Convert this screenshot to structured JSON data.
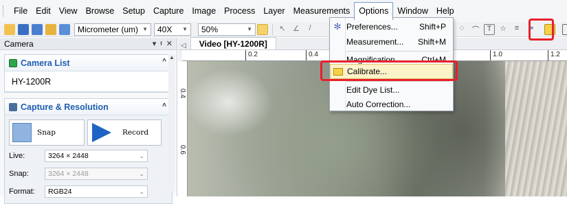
{
  "menubar": {
    "items": [
      "File",
      "Edit",
      "View",
      "Browse",
      "Setup",
      "Capture",
      "Image",
      "Process",
      "Layer",
      "Measurements",
      "Options",
      "Window",
      "Help"
    ],
    "active": "Options"
  },
  "toolbar": {
    "unit_select": "Micrometer (um)",
    "objective_select": "40X",
    "zoom_select": "50%"
  },
  "camera_panel": {
    "title": "Camera",
    "camera_list_title": "Camera List",
    "camera_name": "HY-1200R",
    "capture_title": "Capture & Resolution",
    "snap_label": "Snap",
    "record_label": "Record",
    "live_label": "Live:",
    "live_value": "3264 × 2448",
    "snap_res_label": "Snap:",
    "snap_res_value": "3264 × 2448",
    "format_label": "Format:",
    "format_value": "RGB24"
  },
  "document": {
    "tab_label": "Video [HY-1200R]",
    "ruler_h_labels": [
      "0.2",
      "0.4",
      "1.0",
      "1.2"
    ],
    "ruler_v_labels": [
      "0.4",
      "0.6"
    ]
  },
  "options_menu": {
    "items": [
      {
        "label": "Preferences...",
        "shortcut": "Shift+P",
        "icon": "gear-icon"
      },
      {
        "label": "Measurement...",
        "shortcut": "Shift+M",
        "icon": ""
      },
      {
        "label": "Magnification...",
        "shortcut": "Ctrl+M",
        "icon": ""
      },
      {
        "label": "Calibrate...",
        "shortcut": "",
        "icon": "calibrate-icon"
      },
      {
        "label": "Edit Dye List...",
        "shortcut": "",
        "icon": ""
      },
      {
        "label": "Auto Correction...",
        "shortcut": "",
        "icon": ""
      }
    ],
    "highlighted": "Calibrate..."
  },
  "colors": {
    "highlight_box": "#e8202a",
    "menu_hover": "#fdf3c9",
    "section_title": "#1f5fb0"
  }
}
